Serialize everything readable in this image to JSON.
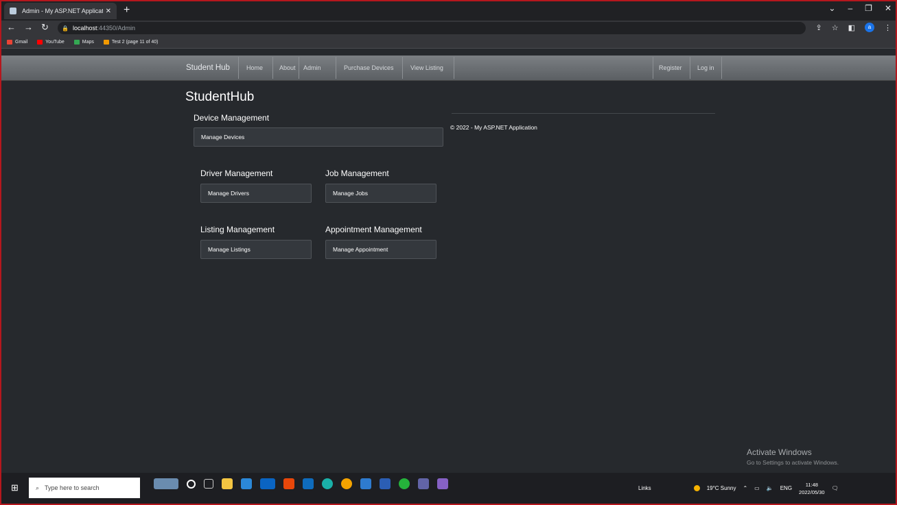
{
  "browser": {
    "tab_title": "Admin - My ASP.NET Application",
    "url_host": "localhost",
    "url_path": ":44350/Admin",
    "bookmarks": [
      {
        "label": "Gmail",
        "color": "#ea4335"
      },
      {
        "label": "YouTube",
        "color": "#ff0000"
      },
      {
        "label": "Maps",
        "color": "#34a853"
      },
      {
        "label": "Test 2 (page 11 of 40)",
        "color": "#f29900"
      }
    ],
    "profile_initial": "a"
  },
  "navbar": {
    "brand": "Student Hub",
    "links": [
      "Home",
      "About",
      "Admin",
      "Purchase Devices",
      "View Listing"
    ],
    "register": "Register",
    "login": "Log in"
  },
  "page": {
    "title": "StudentHub",
    "device": {
      "heading": "Device Management",
      "button": "Manage Devices"
    },
    "driver": {
      "heading": "Driver Management",
      "button": "Manage Drivers"
    },
    "job": {
      "heading": "Job Management",
      "button": "Manage Jobs"
    },
    "listing": {
      "heading": "Listing Management",
      "button": "Manage Listings"
    },
    "appointment": {
      "heading": "Appointment Management",
      "button": "Manage Appointment"
    },
    "footer": "© 2022 - My ASP.NET Application"
  },
  "watermark": {
    "title": "Activate Windows",
    "subtitle": "Go to Settings to activate Windows."
  },
  "taskbar": {
    "search_placeholder": "Type here to search",
    "links": "Links",
    "weather": "19°C Sunny",
    "language": "ENG",
    "time": "11:48",
    "date": "2022/05/30",
    "mail_badge": "99+"
  }
}
